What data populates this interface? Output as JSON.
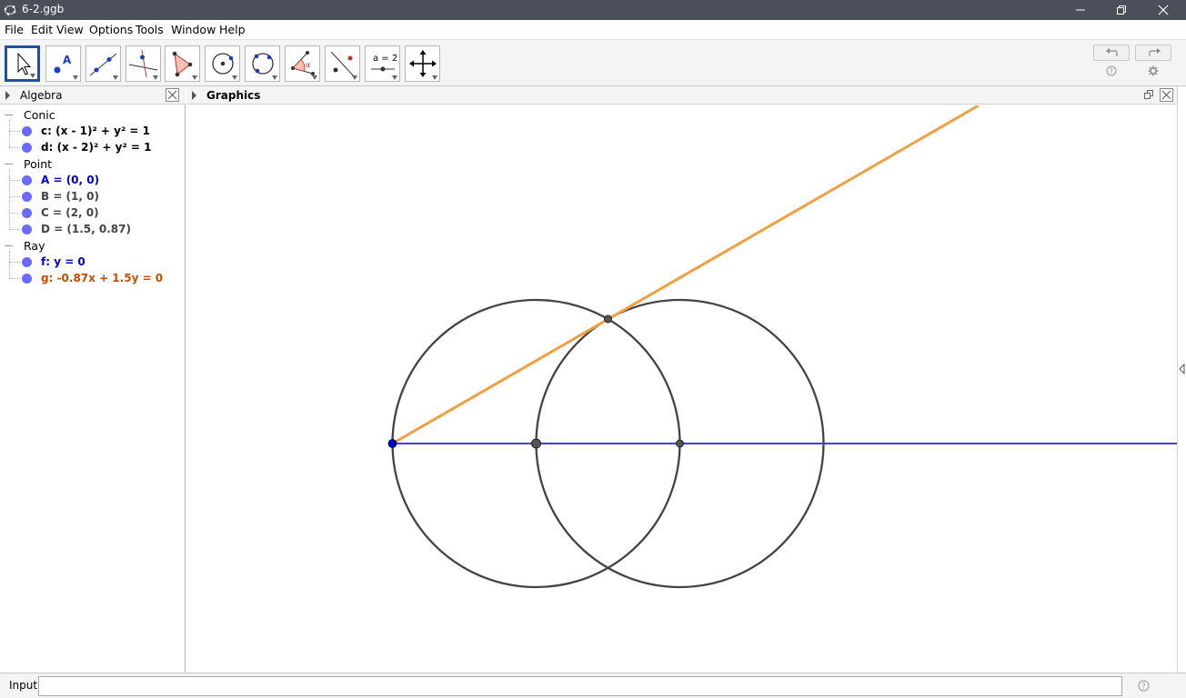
{
  "window": {
    "title": "6-2.ggb"
  },
  "menu": [
    "File",
    "Edit",
    "View",
    "Options",
    "Tools",
    "Window",
    "Help"
  ],
  "toolbar": {
    "tools": [
      {
        "name": "move-tool",
        "icon": "arrow-icon"
      },
      {
        "name": "point-tool",
        "icon": "point-a-icon",
        "label": "A"
      },
      {
        "name": "line-tool",
        "icon": "line-through-two-points-icon"
      },
      {
        "name": "perpendicular-tool",
        "icon": "perpendicular-line-icon"
      },
      {
        "name": "polygon-tool",
        "icon": "polygon-icon"
      },
      {
        "name": "circle-center-point-tool",
        "icon": "circle-with-center-icon"
      },
      {
        "name": "circle-three-points-tool",
        "icon": "circle-three-points-icon"
      },
      {
        "name": "angle-tool",
        "icon": "angle-icon",
        "label": "α"
      },
      {
        "name": "reflect-tool",
        "icon": "reflect-about-line-icon"
      },
      {
        "name": "slider-tool",
        "icon": "slider-icon",
        "label": "a = 2"
      },
      {
        "name": "move-graphics-tool",
        "icon": "move-graphics-view-icon"
      }
    ]
  },
  "algebra": {
    "title": "Algebra",
    "categories": [
      {
        "name": "Conic",
        "items": [
          {
            "text": "c: (x - 1)² + y² = 1",
            "color": "#000000"
          },
          {
            "text": "d: (x - 2)² + y² = 1",
            "color": "#000000"
          }
        ]
      },
      {
        "name": "Point",
        "items": [
          {
            "text": "A = (0, 0)",
            "color": "#0000cc"
          },
          {
            "text": "B = (1, 0)",
            "color": "#444444"
          },
          {
            "text": "C = (2, 0)",
            "color": "#444444"
          },
          {
            "text": "D = (1.5, 0.87)",
            "color": "#444444"
          }
        ]
      },
      {
        "name": "Ray",
        "items": [
          {
            "text": "f: y = 0",
            "color": "#0000cc"
          },
          {
            "text": "g: -0.87x + 1.5y = 0",
            "color": "#c05000"
          }
        ]
      }
    ]
  },
  "graphics": {
    "title": "Graphics"
  },
  "input": {
    "label": "Input:",
    "value": ""
  },
  "colors": {
    "circle": "#444444",
    "ray_f": "#4040e0",
    "ray_g": "#f0a040",
    "point_a": "#0000cc",
    "point_other": "#444444"
  }
}
